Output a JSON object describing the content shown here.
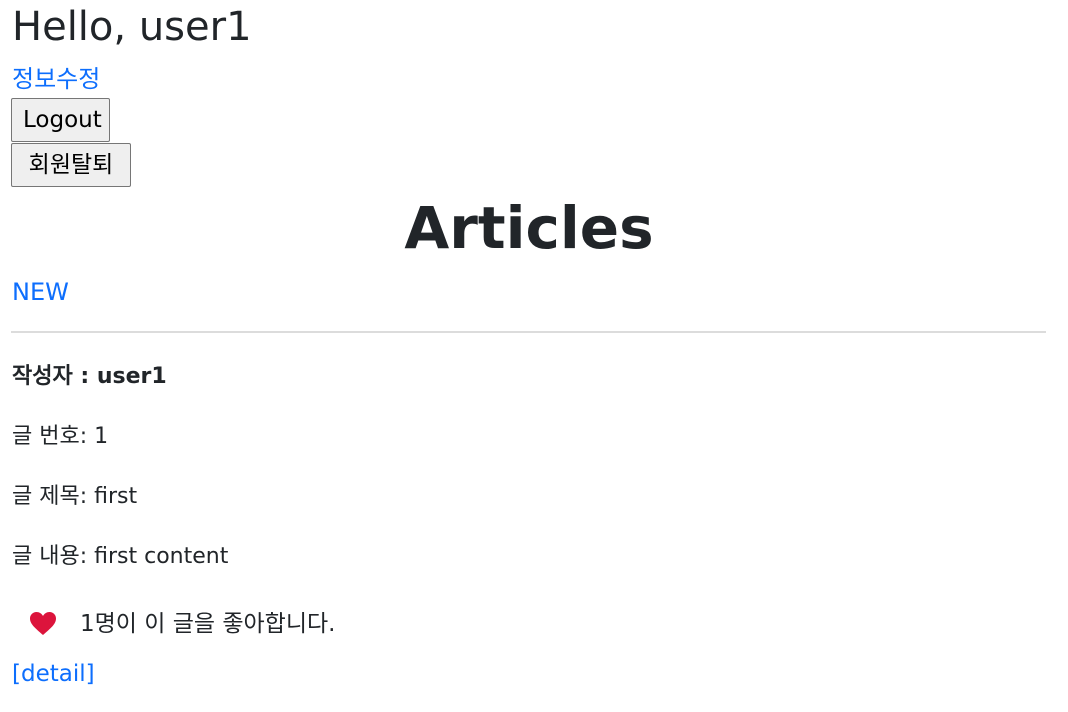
{
  "header": {
    "greeting": "Hello, user1",
    "edit_profile_link": "정보수정",
    "logout_button": "Logout",
    "withdraw_button": "회원탈퇴"
  },
  "main": {
    "title": "Articles",
    "new_link": "NEW"
  },
  "article": {
    "author_label": "작성자 : user1",
    "number_label": "글 번호: 1",
    "title_label": "글 제목: first",
    "content_label": "글 내용: first content",
    "like_text": "1명이 이 글을 좋아합니다.",
    "like_icon": "heart-icon",
    "detail_link": "[detail]"
  },
  "colors": {
    "link": "#0d6efd",
    "heart": "#dc143c",
    "text": "#212529"
  }
}
